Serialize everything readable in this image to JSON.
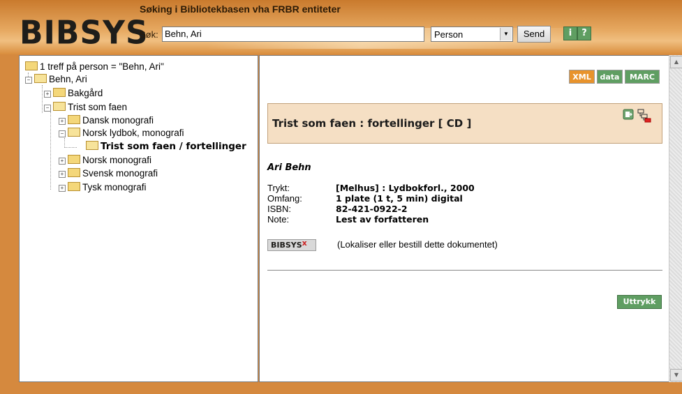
{
  "header": {
    "logo": "BIBSYS",
    "title": "Søking i Bibliotekbasen vha FRBR entiteter",
    "search_label": "Søk:",
    "search_value": "Behn, Ari",
    "search_type_selected": "Person",
    "send_label": "Send",
    "info_icon": "i",
    "help_icon": "?"
  },
  "tree": {
    "root": "1 treff på person = \"Behn, Ari\"",
    "person": "Behn, Ari",
    "bakgard": "Bakgård",
    "trist": "Trist som faen",
    "dansk": "Dansk monografi",
    "norsk_lydbok": "Norsk lydbok, monografi",
    "selected": "Trist som faen / fortellinger",
    "norsk_mono": "Norsk monografi",
    "svensk": "Svensk monografi",
    "tysk": "Tysk monografi"
  },
  "formats": {
    "xml": "XML",
    "data": "data",
    "marc": "MARC"
  },
  "record": {
    "title": "Trist som faen : fortellinger [ CD ]",
    "author": "Ari Behn",
    "fields": [
      {
        "label": "Trykt:",
        "value": "[Melhus] : Lydbokforl., 2000"
      },
      {
        "label": "Omfang:",
        "value": "1 plate (1 t, 5 min) digital"
      },
      {
        "label": "ISBN:",
        "value": "82-421-0922-2"
      },
      {
        "label": "Note:",
        "value": "Lest av forfatteren"
      }
    ],
    "badge": "BIBSYS",
    "badge_mark": "x",
    "lokaliser_text": "(Lokaliser eller bestill dette dokumentet)",
    "uttrykk_label": "Uttrykk"
  },
  "colors": {
    "frame": "#d5893e",
    "title_box": "#f5dfc4",
    "button_green": "#5f9e62",
    "xml_orange": "#e8932c"
  }
}
